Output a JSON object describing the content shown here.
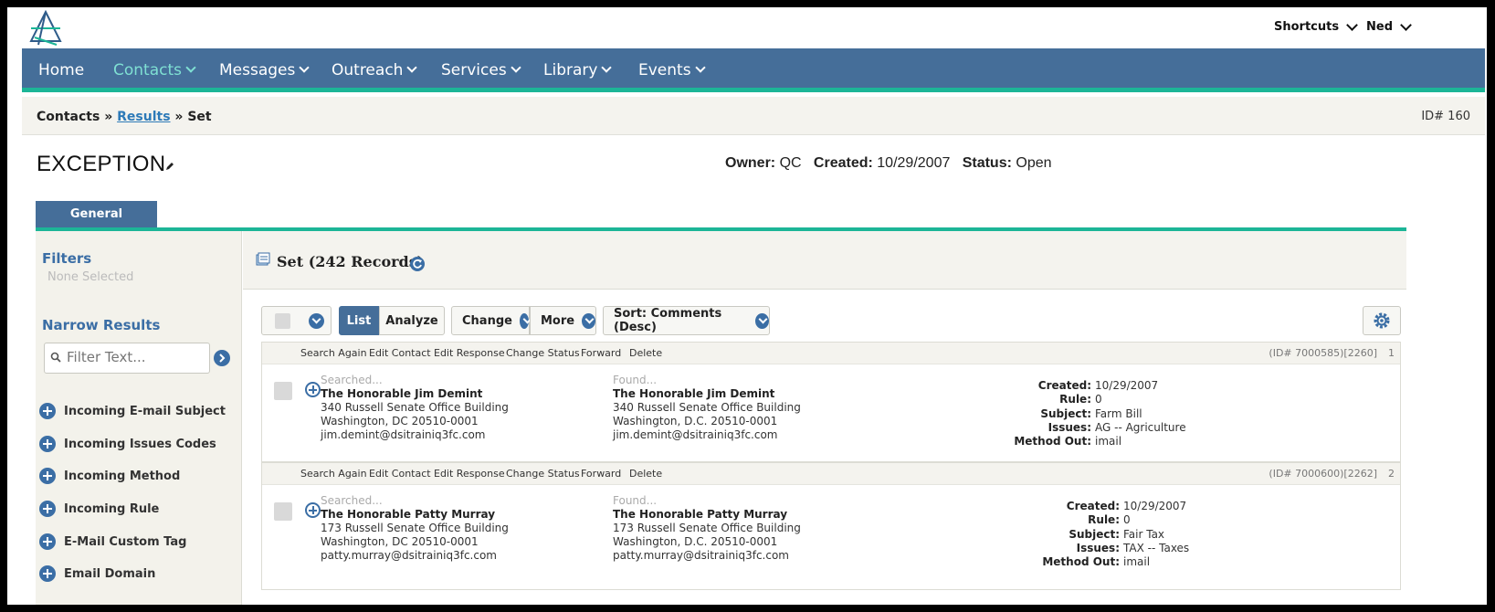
{
  "topbar": {
    "shortcuts": "Shortcuts",
    "user": "Ned"
  },
  "nav": {
    "items": [
      {
        "label": "Home",
        "has_menu": false
      },
      {
        "label": "Contacts",
        "has_menu": true,
        "active": true
      },
      {
        "label": "Messages",
        "has_menu": true
      },
      {
        "label": "Outreach",
        "has_menu": true
      },
      {
        "label": "Services",
        "has_menu": true
      },
      {
        "label": "Library",
        "has_menu": true
      },
      {
        "label": "Events",
        "has_menu": true
      }
    ]
  },
  "breadcrumb": {
    "root": "Contacts",
    "sep": "»",
    "link": "Results",
    "current": "Set",
    "id": "ID# 160"
  },
  "page": {
    "title": "EXCEPTION",
    "owner_label": "Owner:",
    "owner": "QC",
    "created_label": "Created:",
    "created": "10/29/2007",
    "status_label": "Status:",
    "status": "Open"
  },
  "tabs": [
    {
      "label": "General",
      "active": true
    }
  ],
  "sidebar": {
    "filters_title": "Filters",
    "none_selected": "None Selected",
    "narrow_title": "Narrow Results",
    "filter_placeholder": "Filter Text...",
    "facets": [
      "Incoming E-mail Subject",
      "Incoming Issues Codes",
      "Incoming Method",
      "Incoming Rule",
      "E-Mail Custom Tag",
      "Email Domain"
    ]
  },
  "set": {
    "title": "Set (242 Records)"
  },
  "toolbar": {
    "list": "List",
    "analyze": "Analyze",
    "change": "Change",
    "more": "More",
    "sort": "Sort: Comments (Desc)"
  },
  "record_actions": [
    "Search Again",
    "Edit Contact",
    "Edit Response",
    "Change Status",
    "Forward",
    "Delete"
  ],
  "records": [
    {
      "id": "(ID# 7000585)[2260]",
      "num": "1",
      "searched_label": "Searched...",
      "searched": {
        "name": "The Honorable Jim Demint",
        "line1": "340 Russell Senate Office Building",
        "line2": "Washington, DC 20510-0001",
        "email": "jim.demint@dsitrainiq3fc.com"
      },
      "found_label": "Found...",
      "found": {
        "name": "The Honorable Jim Demint",
        "line1": "340 Russell Senate Office Building",
        "line2": "Washington, D.C. 20510-0001",
        "email": "jim.demint@dsitrainiq3fc.com"
      },
      "details": {
        "created_label": "Created:",
        "created": "10/29/2007",
        "rule_label": "Rule:",
        "rule": "0",
        "subject_label": "Subject:",
        "subject": "Farm Bill",
        "issues_label": "Issues:",
        "issues": "AG -- Agriculture",
        "method_label": "Method Out:",
        "method": "imail"
      }
    },
    {
      "id": "(ID# 7000600)[2262]",
      "num": "2",
      "searched_label": "Searched...",
      "searched": {
        "name": "The Honorable Patty Murray",
        "line1": "173 Russell Senate Office Building",
        "line2": "Washington, DC 20510-0001",
        "email": "patty.murray@dsitrainiq3fc.com"
      },
      "found_label": "Found...",
      "found": {
        "name": "The Honorable Patty Murray",
        "line1": "173 Russell Senate Office Building",
        "line2": "Washington, D.C. 20510-0001",
        "email": "patty.murray@dsitrainiq3fc.com"
      },
      "details": {
        "created_label": "Created:",
        "created": "10/29/2007",
        "rule_label": "Rule:",
        "rule": "0",
        "subject_label": "Subject:",
        "subject": "Fair Tax",
        "issues_label": "Issues:",
        "issues": "TAX -- Taxes",
        "method_label": "Method Out:",
        "method": "imail"
      }
    }
  ],
  "colors": {
    "nav": "#456e99",
    "accent": "#1cb597",
    "link": "#2d7ab8"
  }
}
